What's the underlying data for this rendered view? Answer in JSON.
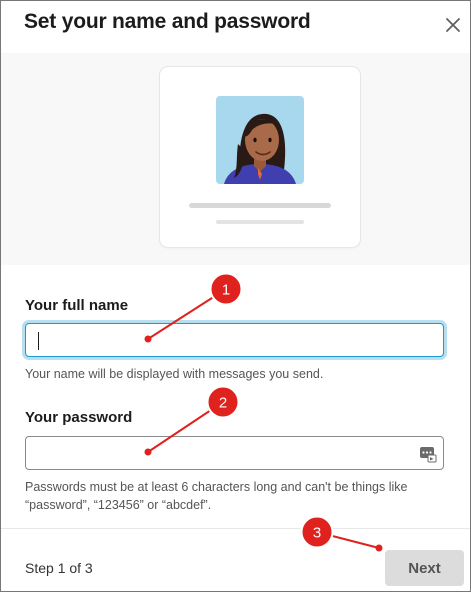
{
  "dialog": {
    "title": "Set your name and password",
    "close_icon": "close-icon"
  },
  "hero": {
    "avatar_icon": "person-avatar-icon"
  },
  "name_field": {
    "label": "Your full name",
    "value": "",
    "placeholder": "",
    "hint": "Your name will be displayed with messages you send."
  },
  "password_field": {
    "label": "Your password",
    "value": "",
    "placeholder": "",
    "icon": "password-manager-icon",
    "hint": "Passwords must be at least 6 characters long and can't be things like “password”, “123456” or “abcdef”."
  },
  "footer": {
    "step": "Step 1 of 3",
    "next_label": "Next"
  },
  "annotations": [
    {
      "number": "1"
    },
    {
      "number": "2"
    },
    {
      "number": "3"
    }
  ],
  "colors": {
    "annotation_red": "#e0221f",
    "focus_blue": "#1d9bd1",
    "avatar_bg": "#a8d8ee",
    "shirt_blue": "#3f3fb0"
  }
}
